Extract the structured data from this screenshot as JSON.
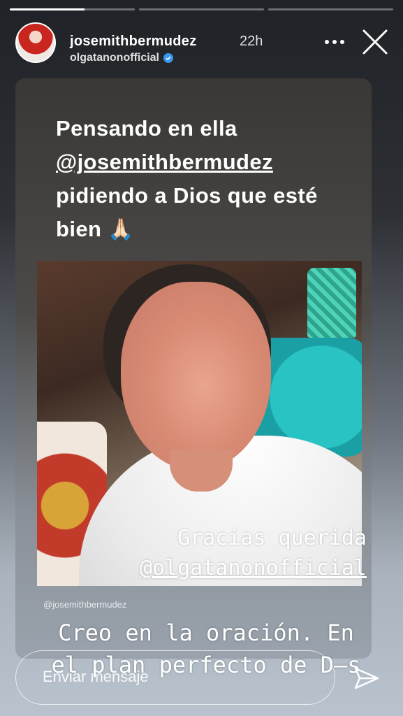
{
  "progress": {
    "segments": [
      0.6,
      1,
      1
    ]
  },
  "header": {
    "username": "josemithbermudez",
    "time": "22h",
    "subuser": "olgatanonofficial"
  },
  "story": {
    "line1": "Pensando en ella",
    "mention": "@josemithbermudez",
    "line3": "pidiendo a Dios que esté",
    "line4": "bien",
    "emoji": "🙏🏻"
  },
  "photo": {
    "caption1": "Gracias querida",
    "caption2": "@olgatanonofficial"
  },
  "credit": "@josemithbermudez",
  "creo": {
    "line1": "Creo  en la oración. En",
    "line2": "el plan perfecto de D—s"
  },
  "reply": {
    "placeholder": "Enviar mensaje"
  },
  "colors": {
    "verified": "#3897f0"
  }
}
